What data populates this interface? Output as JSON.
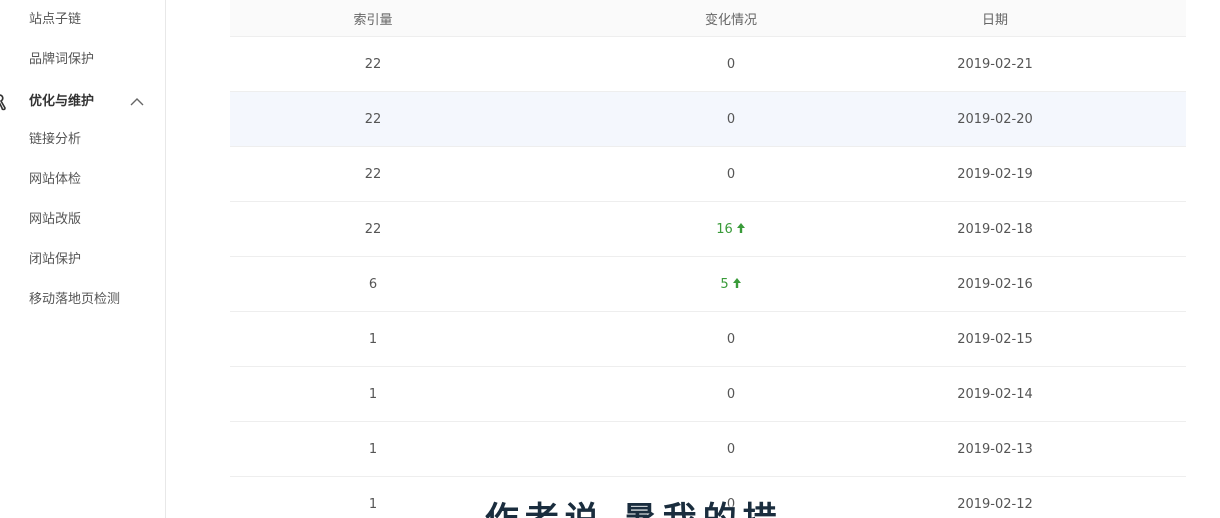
{
  "sidebar": {
    "top_items": [
      "站点子链",
      "品牌词保护"
    ],
    "group": {
      "label": "优化与维护",
      "icon": "wrench-icon",
      "chevron": "chevron-up-icon",
      "items": [
        "链接分析",
        "网站体检",
        "网站改版",
        "闭站保护",
        "移动落地页检测"
      ]
    }
  },
  "table": {
    "headers": [
      "索引量",
      "变化情况",
      "日期"
    ],
    "rows": [
      {
        "index": "22",
        "change": "0",
        "trend": "none",
        "date": "2019-02-21"
      },
      {
        "index": "22",
        "change": "0",
        "trend": "none",
        "date": "2019-02-20"
      },
      {
        "index": "22",
        "change": "0",
        "trend": "none",
        "date": "2019-02-19"
      },
      {
        "index": "22",
        "change": "16",
        "trend": "up",
        "date": "2019-02-18"
      },
      {
        "index": "6",
        "change": "5",
        "trend": "up",
        "date": "2019-02-16"
      },
      {
        "index": "1",
        "change": "0",
        "trend": "none",
        "date": "2019-02-15"
      },
      {
        "index": "1",
        "change": "0",
        "trend": "none",
        "date": "2019-02-14"
      },
      {
        "index": "1",
        "change": "0",
        "trend": "none",
        "date": "2019-02-13"
      },
      {
        "index": "1",
        "change": "0",
        "trend": "none",
        "date": "2019-02-12"
      }
    ],
    "highlight_row": 1,
    "up_color": "#3a9b3a"
  },
  "overlay": {
    "text": "...作者说 暑我的措"
  }
}
